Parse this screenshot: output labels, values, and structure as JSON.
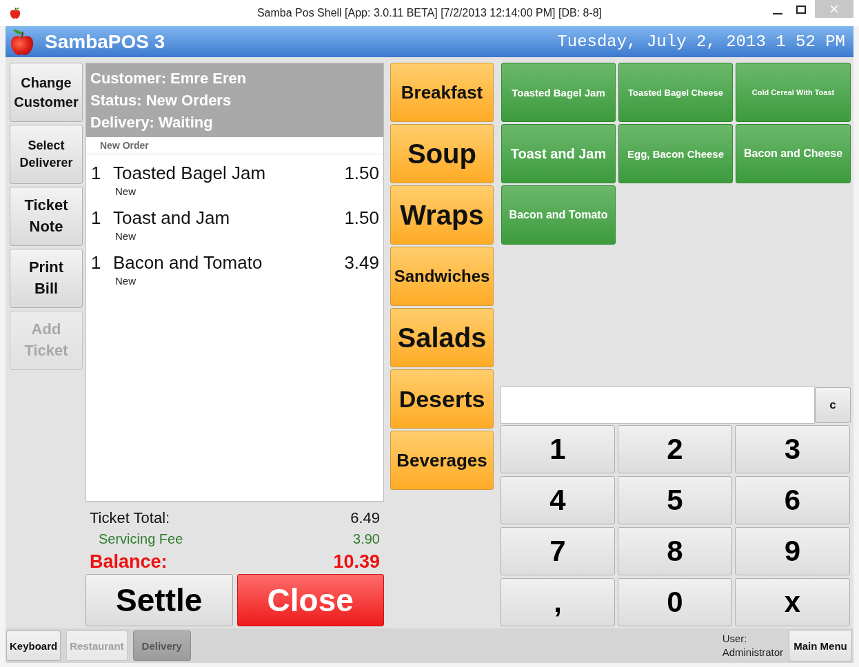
{
  "window": {
    "title": "Samba Pos Shell [App: 3.0.11 BETA] [7/2/2013 12:14:00 PM] [DB: 8-8]"
  },
  "header": {
    "app_name": "SambaPOS 3",
    "datetime": "Tuesday, July 2, 2013 1 52 PM"
  },
  "ticket_commands": [
    {
      "label": "Change Customer",
      "disabled": false
    },
    {
      "label": "Select Deliverer",
      "disabled": false
    },
    {
      "label": "Ticket Note",
      "disabled": false
    },
    {
      "label": "Print Bill",
      "disabled": false
    },
    {
      "label": "Add Ticket",
      "disabled": true
    }
  ],
  "ticket": {
    "info": [
      "Customer: Emre Eren",
      "Status: New Orders",
      "Delivery: Waiting"
    ],
    "group": "New Order",
    "orders": [
      {
        "quantity": "1",
        "name": "Toasted Bagel Jam",
        "price": "1.50",
        "status": "New"
      },
      {
        "quantity": "1",
        "name": "Toast and Jam",
        "price": "1.50",
        "status": "New"
      },
      {
        "quantity": "1",
        "name": "Bacon and Tomato",
        "price": "3.49",
        "status": "New"
      }
    ]
  },
  "totals": [
    {
      "kind": "total",
      "label": "Ticket Total:",
      "value": "6.49"
    },
    {
      "kind": "fee",
      "label": "Servicing Fee",
      "value": "3.90"
    },
    {
      "kind": "balance",
      "label": "Balance:",
      "value": "10.39"
    }
  ],
  "actions": [
    {
      "kind": "settle",
      "label": "Settle"
    },
    {
      "kind": "close",
      "label": "Close"
    }
  ],
  "categories": [
    "Breakfast",
    "Soup",
    "Wraps",
    "Sandwiches",
    "Salads",
    "Deserts",
    "Beverages"
  ],
  "products": [
    "Toasted Bagel Jam",
    "Toasted Bagel Cheese",
    "Cold Cereal With Toast",
    "Toast and Jam",
    "Egg, Bacon Cheese",
    "Bacon and Cheese",
    "Bacon and Tomato"
  ],
  "numpad": {
    "clear": "c",
    "keys": [
      "1",
      "2",
      "3",
      "4",
      "5",
      "6",
      "7",
      "8",
      "9",
      ",",
      "0",
      "x"
    ]
  },
  "status_bar": {
    "buttons": [
      {
        "label": "Keyboard",
        "disabled": false,
        "selected": false
      },
      {
        "label": "Restaurant",
        "disabled": true,
        "selected": false
      },
      {
        "label": "Delivery",
        "disabled": false,
        "selected": true
      }
    ],
    "user_label": "User:",
    "user_name": "Administrator",
    "main_menu": "Main Menu"
  }
}
